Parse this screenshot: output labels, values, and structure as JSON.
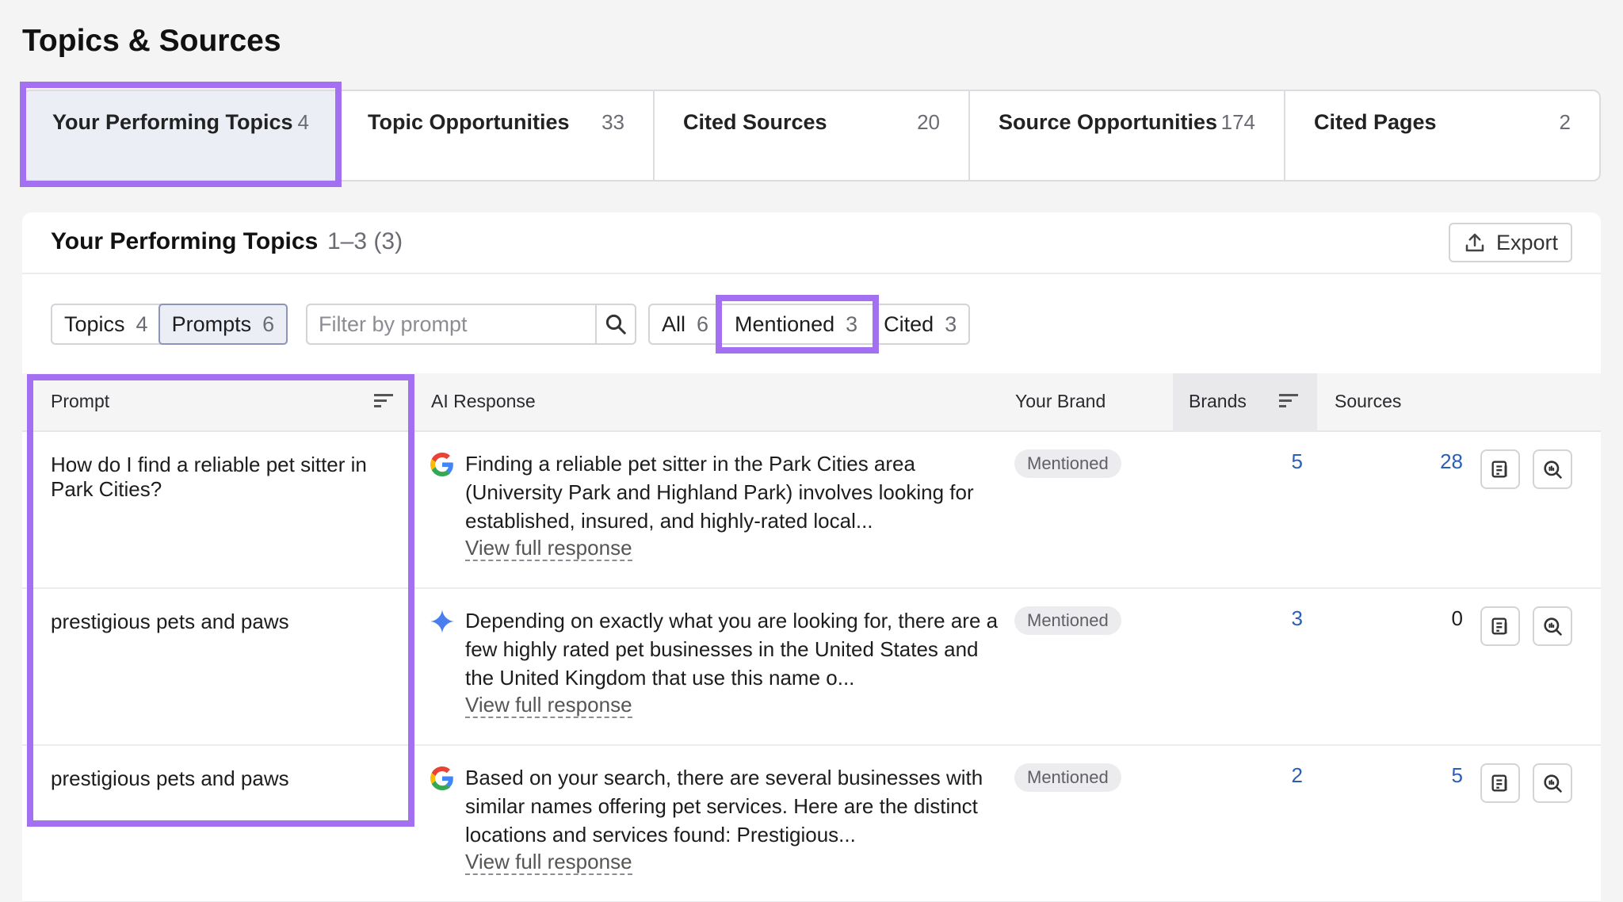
{
  "page": {
    "title": "Topics & Sources"
  },
  "tabs": [
    {
      "label": "Your Performing Topics",
      "count": "4"
    },
    {
      "label": "Topic Opportunities",
      "count": "33"
    },
    {
      "label": "Cited Sources",
      "count": "20"
    },
    {
      "label": "Source Opportunities",
      "count": "174"
    },
    {
      "label": "Cited Pages",
      "count": "2"
    }
  ],
  "card": {
    "title": "Your Performing Topics",
    "range": "1–3 (3)",
    "export_label": "Export"
  },
  "view_toggle": [
    {
      "label": "Topics",
      "count": "4"
    },
    {
      "label": "Prompts",
      "count": "6",
      "selected": true
    }
  ],
  "filter": {
    "placeholder": "Filter by prompt"
  },
  "status_filter": [
    {
      "label": "All",
      "count": "6"
    },
    {
      "label": "Mentioned",
      "count": "3"
    },
    {
      "label": "Cited",
      "count": "3"
    }
  ],
  "table": {
    "headers": {
      "prompt": "Prompt",
      "ai_response": "AI Response",
      "your_brand": "Your Brand",
      "brands": "Brands",
      "sources": "Sources"
    },
    "view_link_label": "View full response",
    "rows": [
      {
        "prompt": "How do I find a reliable pet sitter in Park Cities?",
        "engine_icon": "google-icon",
        "response": "Finding a reliable pet sitter in the Park Cities area (University Park and Highland Park) involves looking for established, insured, and highly-rated local...",
        "your_brand": "Mentioned",
        "brands": "5",
        "sources": "28"
      },
      {
        "prompt": "prestigious pets and paws",
        "engine_icon": "gemini-icon",
        "response": "Depending on exactly what you are looking for, there are a few highly rated pet businesses in the United States and the United Kingdom that use this name o...",
        "your_brand": "Mentioned",
        "brands": "3",
        "sources": "0"
      },
      {
        "prompt": "prestigious pets and paws",
        "engine_icon": "google-icon",
        "response": "Based on your search, there are several businesses with similar names offering pet services. Here are the distinct locations and services found: Prestigious...",
        "your_brand": "Mentioned",
        "brands": "2",
        "sources": "5"
      }
    ]
  },
  "colors": {
    "highlight": "#a270f0",
    "link": "#2a5fb5",
    "active_tab_bg": "#eceef6"
  }
}
